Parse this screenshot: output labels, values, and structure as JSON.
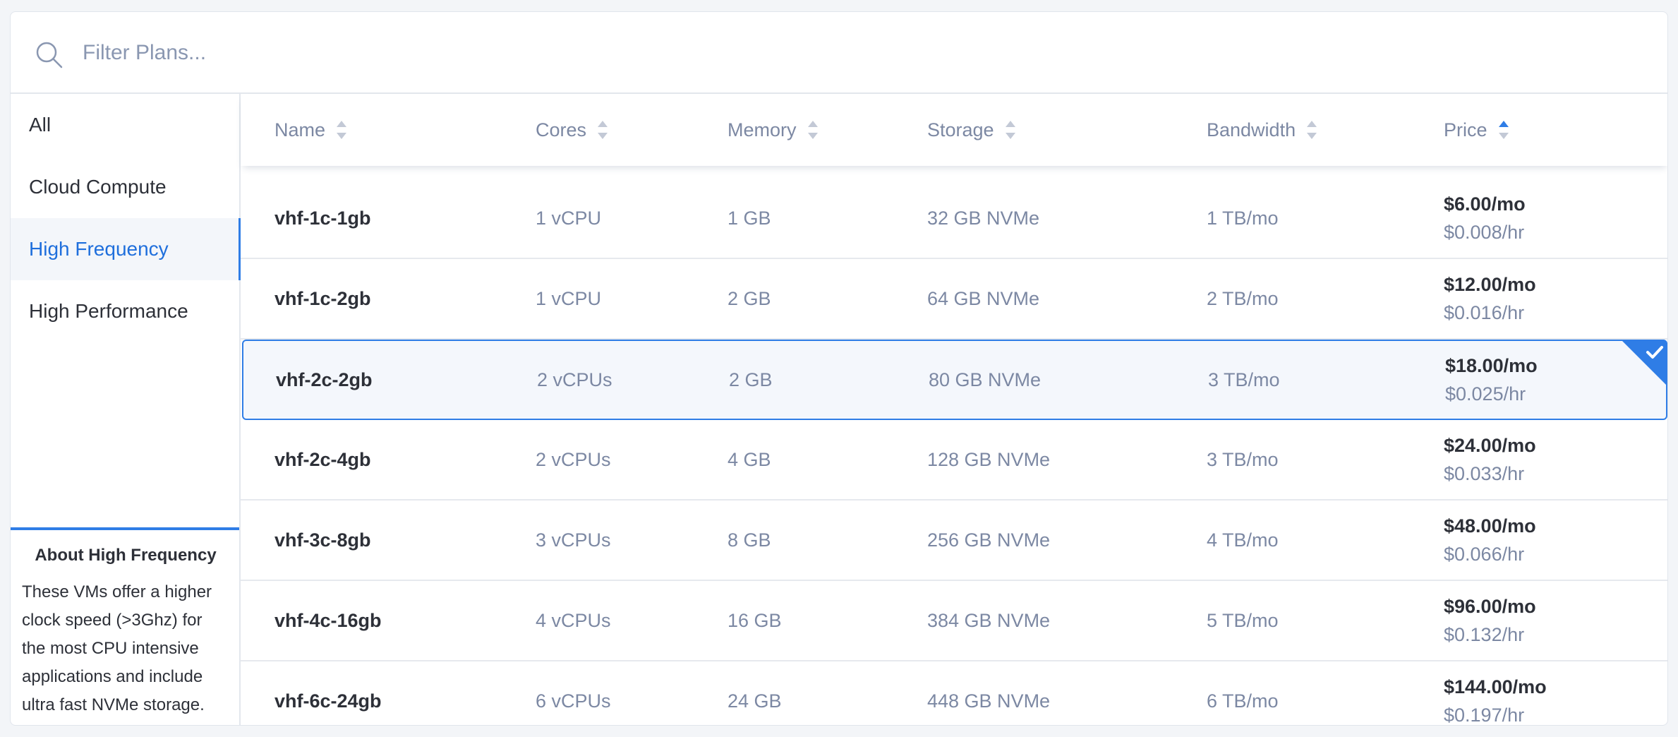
{
  "search": {
    "placeholder": "Filter Plans..."
  },
  "sidebar": {
    "categories": [
      {
        "label": "All"
      },
      {
        "label": "Cloud Compute"
      },
      {
        "label": "High Frequency"
      },
      {
        "label": "High Performance"
      }
    ],
    "active_index": 2,
    "about": {
      "title": "About High Frequency",
      "text": "These VMs offer a higher clock speed (>3Ghz) for the most CPU intensive applications and include ultra fast NVMe storage."
    }
  },
  "table": {
    "headers": {
      "name": "Name",
      "cores": "Cores",
      "memory": "Memory",
      "storage": "Storage",
      "bandwidth": "Bandwidth",
      "price": "Price"
    },
    "sorted_by": "price",
    "sort_direction": "ascending",
    "selected_index": 2,
    "rows": [
      {
        "name": "vhf-1c-1gb",
        "cores": "1 vCPU",
        "memory": "1 GB",
        "storage": "32 GB NVMe",
        "bandwidth": "1 TB/mo",
        "price_mo": "$6.00/mo",
        "price_hr": "$0.008/hr"
      },
      {
        "name": "vhf-1c-2gb",
        "cores": "1 vCPU",
        "memory": "2 GB",
        "storage": "64 GB NVMe",
        "bandwidth": "2 TB/mo",
        "price_mo": "$12.00/mo",
        "price_hr": "$0.016/hr"
      },
      {
        "name": "vhf-2c-2gb",
        "cores": "2 vCPUs",
        "memory": "2 GB",
        "storage": "80 GB NVMe",
        "bandwidth": "3 TB/mo",
        "price_mo": "$18.00/mo",
        "price_hr": "$0.025/hr"
      },
      {
        "name": "vhf-2c-4gb",
        "cores": "2 vCPUs",
        "memory": "4 GB",
        "storage": "128 GB NVMe",
        "bandwidth": "3 TB/mo",
        "price_mo": "$24.00/mo",
        "price_hr": "$0.033/hr"
      },
      {
        "name": "vhf-3c-8gb",
        "cores": "3 vCPUs",
        "memory": "8 GB",
        "storage": "256 GB NVMe",
        "bandwidth": "4 TB/mo",
        "price_mo": "$48.00/mo",
        "price_hr": "$0.066/hr"
      },
      {
        "name": "vhf-4c-16gb",
        "cores": "4 vCPUs",
        "memory": "16 GB",
        "storage": "384 GB NVMe",
        "bandwidth": "5 TB/mo",
        "price_mo": "$96.00/mo",
        "price_hr": "$0.132/hr"
      },
      {
        "name": "vhf-6c-24gb",
        "cores": "6 vCPUs",
        "memory": "24 GB",
        "storage": "448 GB NVMe",
        "bandwidth": "6 TB/mo",
        "price_mo": "$144.00/mo",
        "price_hr": "$0.197/hr"
      }
    ]
  },
  "colors": {
    "accent": "#2f7de6",
    "text_dark": "#2d3038",
    "text_muted": "#7c88a3"
  },
  "icons": {
    "search": "search-icon",
    "selected_check": "checkmark-icon"
  }
}
